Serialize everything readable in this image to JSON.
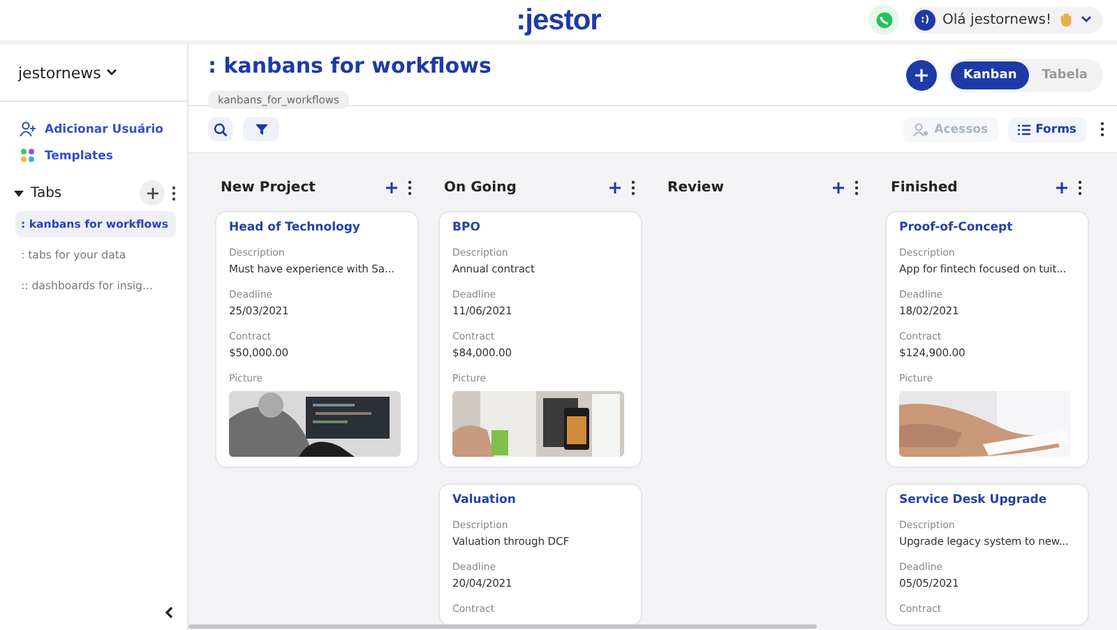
{
  "top_bar": {
    "logo": ":jestor",
    "greeting": "Olá jestornews!",
    "avatar": ":)"
  },
  "sidebar": {
    "workspace": "jestornews",
    "links": [
      "Adicionar Usuário",
      "Templates"
    ],
    "tabs_section": {
      "title": "Tabs",
      "expanded": true
    },
    "tabs": [
      {
        "label": ": kanbans for workflows",
        "selected": true
      },
      {
        "label": ": tabs for your data",
        "selected": false
      },
      {
        "label": ":: dashboards for insig...",
        "selected": false
      }
    ]
  },
  "header": {
    "title": ": kanbans for workflows",
    "slug": "kanbans_for_workflows",
    "views": [
      {
        "label": "Kanban",
        "selected": true
      },
      {
        "label": "Tabela",
        "selected": false
      }
    ]
  },
  "toolbar": {
    "buttons": [
      {
        "label": "Acessos",
        "disabled": true
      },
      {
        "label": "Forms",
        "disabled": false
      }
    ]
  },
  "board": {
    "columns": [
      {
        "title": "New Project",
        "cards": [
          {
            "title": "Head of Technology",
            "fields": [
              {
                "kind": "text",
                "label": "Description",
                "value": "Must have experience with Sa..."
              },
              {
                "kind": "text",
                "label": "Deadline",
                "value": "25/03/2021"
              },
              {
                "kind": "text",
                "label": "Contract",
                "value": "$50,000.00"
              },
              {
                "kind": "picture",
                "label": "Picture"
              }
            ]
          }
        ]
      },
      {
        "title": "On Going",
        "cards": [
          {
            "title": "BPO",
            "fields": [
              {
                "kind": "text",
                "label": "Description",
                "value": "Annual contract"
              },
              {
                "kind": "text",
                "label": "Deadline",
                "value": "11/06/2021"
              },
              {
                "kind": "text",
                "label": "Contract",
                "value": "$84,000.00"
              },
              {
                "kind": "picture",
                "label": "Picture"
              }
            ]
          },
          {
            "title": "Valuation",
            "fields": [
              {
                "kind": "text",
                "label": "Description",
                "value": "Valuation through DCF"
              },
              {
                "kind": "text",
                "label": "Deadline",
                "value": "20/04/2021"
              },
              {
                "kind": "text",
                "label": "Contract"
              }
            ]
          }
        ]
      },
      {
        "title": "Review"
      },
      {
        "title": "Finished",
        "cards": [
          {
            "title": "Proof-of-Concept",
            "fields": [
              {
                "kind": "text",
                "label": "Description",
                "value": "App for fintech focused on tuit..."
              },
              {
                "kind": "text",
                "label": "Deadline",
                "value": "18/02/2021"
              },
              {
                "kind": "text",
                "label": "Contract",
                "value": "$124,900.00"
              },
              {
                "kind": "picture",
                "label": "Picture"
              }
            ]
          },
          {
            "title": "Service Desk Upgrade",
            "fields": [
              {
                "kind": "text",
                "label": "Description",
                "value": "Upgrade legacy system to new..."
              },
              {
                "kind": "text",
                "label": "Deadline",
                "value": "05/05/2021"
              },
              {
                "kind": "text",
                "label": "Contract"
              }
            ]
          }
        ]
      }
    ]
  }
}
